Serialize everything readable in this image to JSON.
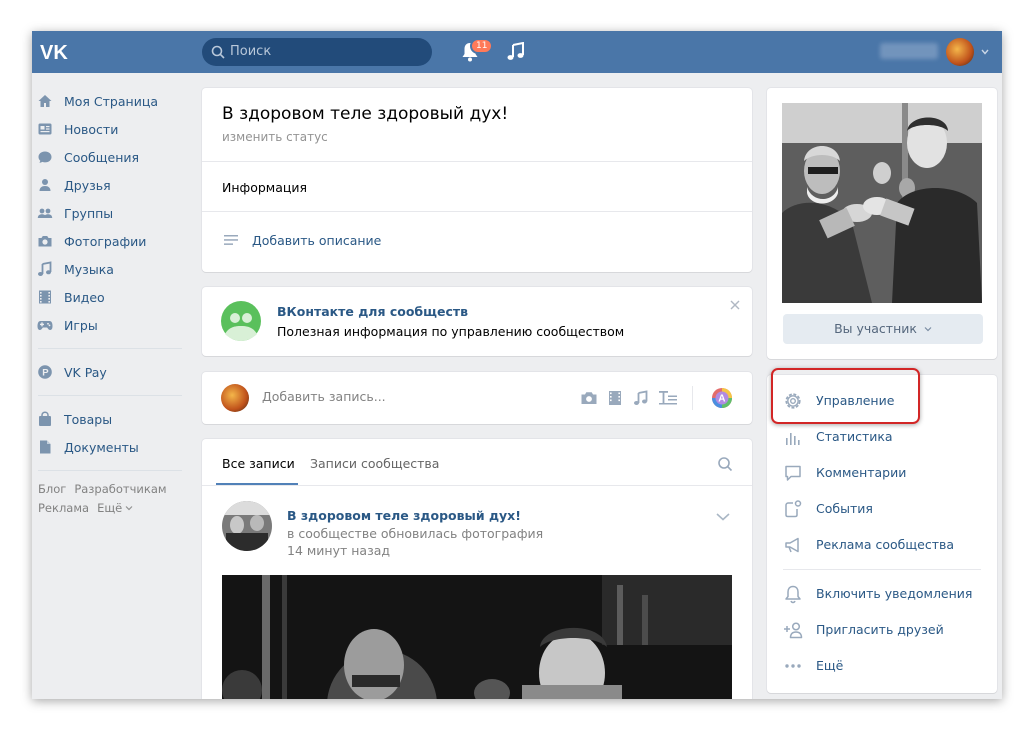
{
  "header": {
    "logo": "VK",
    "search_placeholder": "Поиск",
    "notifications_count": "11",
    "username": "Дмитрий"
  },
  "sidebar": {
    "items": [
      {
        "label": "Моя Страница",
        "icon": "home-icon"
      },
      {
        "label": "Новости",
        "icon": "news-icon"
      },
      {
        "label": "Сообщения",
        "icon": "messages-icon"
      },
      {
        "label": "Друзья",
        "icon": "friends-icon"
      },
      {
        "label": "Группы",
        "icon": "groups-icon"
      },
      {
        "label": "Фотографии",
        "icon": "camera-icon"
      },
      {
        "label": "Музыка",
        "icon": "music-icon"
      },
      {
        "label": "Видео",
        "icon": "video-icon"
      },
      {
        "label": "Игры",
        "icon": "games-icon"
      },
      {
        "label": "VK Pay",
        "icon": "vkpay-icon"
      },
      {
        "label": "Товары",
        "icon": "shop-bag-icon"
      },
      {
        "label": "Документы",
        "icon": "document-icon"
      }
    ],
    "footer": [
      "Блог",
      "Разработчикам",
      "Реклама",
      "Ещё"
    ]
  },
  "status": {
    "title": "В здоровом теле здоровый дух!",
    "change": "изменить статус",
    "info": "Информация",
    "add_description": "Добавить описание"
  },
  "promo": {
    "title": "ВКонтакте для сообществ",
    "text": "Полезная информация по управлению сообществом"
  },
  "composer": {
    "placeholder": "Добавить запись..."
  },
  "wall": {
    "tabs": [
      "Все записи",
      "Записи сообщества"
    ],
    "post": {
      "author": "В здоровом теле здоровый дух!",
      "action": "в сообществе обновилась фотография",
      "time": "14 минут назад"
    }
  },
  "right": {
    "member_button": "Вы участник",
    "menu": [
      {
        "label": "Управление",
        "icon": "gear-icon"
      },
      {
        "label": "Статистика",
        "icon": "stats-icon"
      },
      {
        "label": "Комментарии",
        "icon": "comment-icon"
      },
      {
        "label": "События",
        "icon": "events-icon"
      },
      {
        "label": "Реклама сообщества",
        "icon": "megaphone-icon"
      },
      {
        "label": "Включить уведомления",
        "icon": "bell-icon"
      },
      {
        "label": "Пригласить друзей",
        "icon": "invite-icon"
      },
      {
        "label": "Ещё",
        "icon": "more-icon"
      }
    ]
  },
  "colors": {
    "header": "#4a76a8",
    "link": "#2a5885",
    "background": "#edeef0",
    "highlight": "#d22626"
  }
}
